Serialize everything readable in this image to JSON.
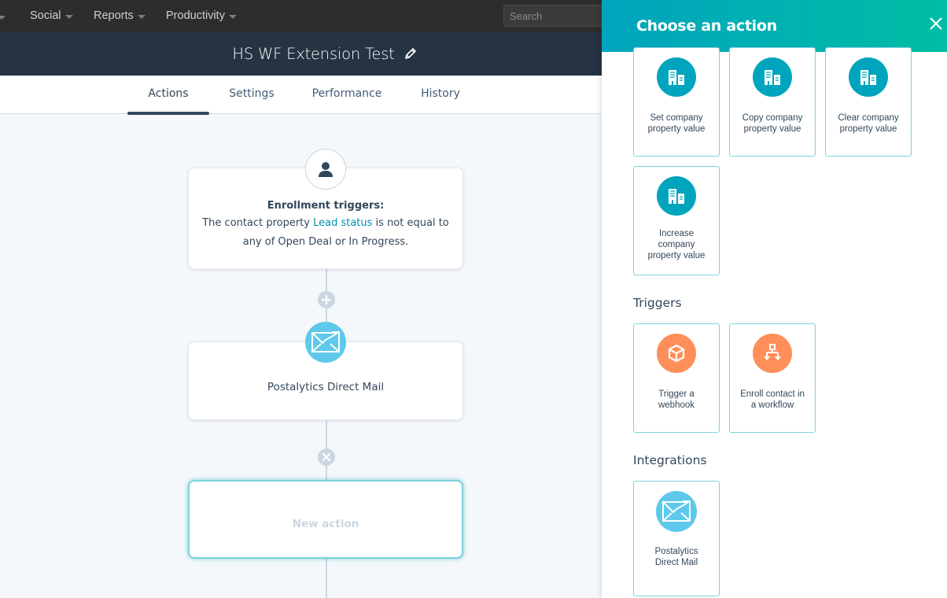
{
  "topnav": {
    "items": [
      {
        "label": "Social"
      },
      {
        "label": "Reports"
      },
      {
        "label": "Productivity"
      }
    ],
    "search_placeholder": "Search"
  },
  "header": {
    "title": "HS WF Extension Test",
    "edit_icon": "pencil-icon"
  },
  "tabs": [
    {
      "label": "Actions",
      "active": true
    },
    {
      "label": "Settings",
      "active": false
    },
    {
      "label": "Performance",
      "active": false
    },
    {
      "label": "History",
      "active": false
    }
  ],
  "workflow": {
    "enrollment": {
      "icon": "contact-icon",
      "title": "Enrollment triggers:",
      "desc_prefix": "The contact property ",
      "property_link": "Lead status",
      "desc_middle": " is not equal to",
      "desc_line2": "any of Open Deal or In Progress."
    },
    "add_button_icon": "plus-icon",
    "action": {
      "icon": "mail-icon",
      "title": "Postalytics Direct Mail"
    },
    "remove_button_icon": "close-icon",
    "new_action": {
      "label": "New action"
    }
  },
  "panel": {
    "title": "Choose an action",
    "close_icon": "close-icon",
    "company_actions": [
      {
        "label": "Set company property value",
        "icon": "building-icon"
      },
      {
        "label": "Copy company property value",
        "icon": "building-icon"
      },
      {
        "label": "Clear company property value",
        "icon": "building-icon"
      },
      {
        "label": "Increase company property value",
        "icon": "building-icon"
      }
    ],
    "sections": {
      "triggers": "Triggers",
      "integrations": "Integrations"
    },
    "trigger_actions": [
      {
        "label": "Trigger a webhook",
        "icon": "cube-icon"
      },
      {
        "label": "Enroll contact in a workflow",
        "icon": "workflow-icon"
      }
    ],
    "integration_actions": [
      {
        "label": "Postalytics Direct Mail",
        "icon": "mail-icon"
      }
    ],
    "colors": {
      "company": "#00a4bd",
      "trigger": "#ff8f59",
      "integration": "#5ec9ea",
      "header_start": "#00a4bd",
      "header_end": "#00bda5"
    }
  }
}
